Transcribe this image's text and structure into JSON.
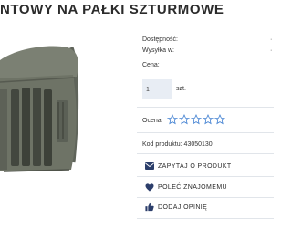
{
  "product": {
    "title": "NTOWY NA PAŁKI SZTURMOWE",
    "image_alt": "",
    "availability_label": "Dostępność:",
    "availability_value": "",
    "shipping_label": "Wysyłka w:",
    "shipping_value": "",
    "price_label": "Cena:",
    "price_value": "",
    "quantity": {
      "value": "1",
      "unit": "szt."
    },
    "rating": {
      "label": "Ocena:",
      "filled_stars": 0,
      "max_stars": 5
    },
    "code_label": "Kod produktu:",
    "code_value": "43050130"
  },
  "actions": {
    "ask": {
      "label": "ZAPYTAJ O PRODUKT",
      "icon": "envelope-icon"
    },
    "recommend": {
      "label": "POLEĆ ZNAJOMEMU",
      "icon": "heart-icon"
    },
    "review": {
      "label": "DODAJ OPINIĘ",
      "icon": "thumbs-up-icon"
    }
  },
  "colors": {
    "accent": "#2c3e6b",
    "star_outline": "#3f7fd1",
    "input_bg": "#e8edf4",
    "photo_bag": "#6e7366"
  }
}
